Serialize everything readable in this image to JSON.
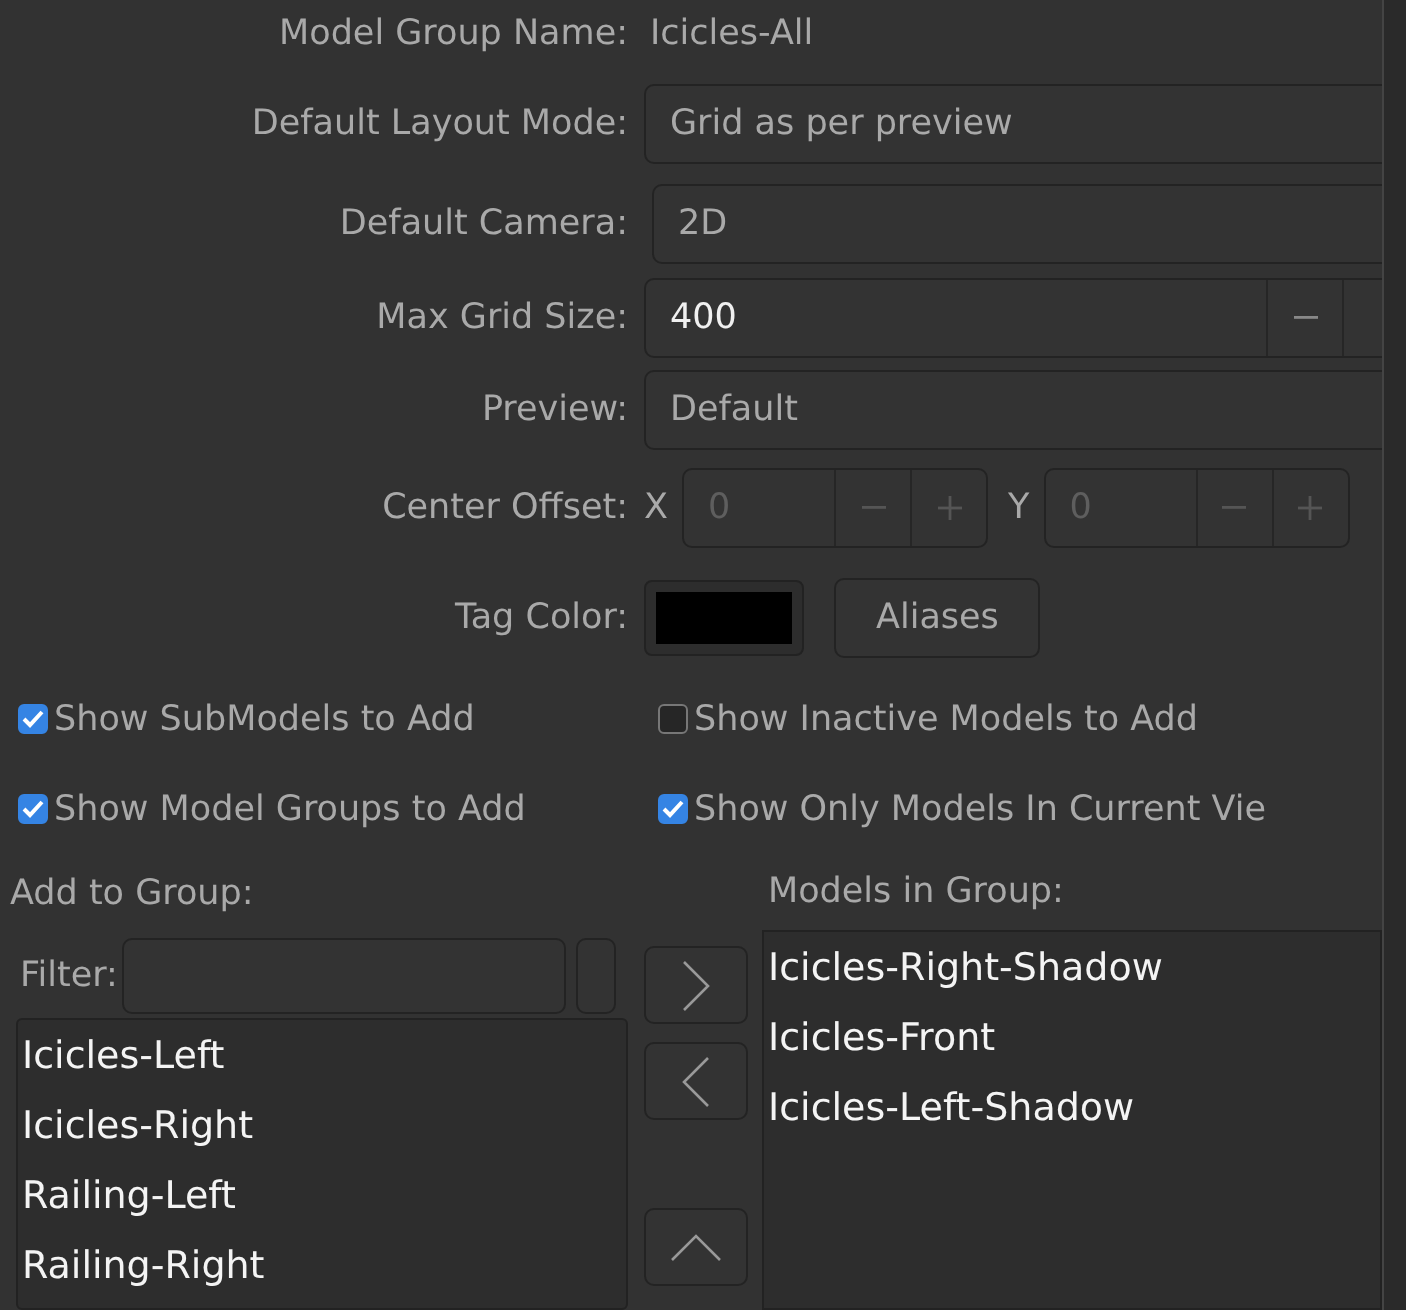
{
  "form": [
    {
      "kind": "text",
      "label": "Model Group Name:",
      "value": "Icicles-All"
    },
    {
      "kind": "dropdown",
      "label": "Default Layout Mode:",
      "value": "Grid as per preview"
    },
    {
      "kind": "dropdown",
      "label": "Default Camera:",
      "value": "2D"
    },
    {
      "kind": "spin",
      "label": "Max Grid Size:",
      "value": "400"
    },
    {
      "kind": "dropdown",
      "label": "Preview:",
      "value": "Default"
    },
    {
      "kind": "offset",
      "label": "Center Offset:",
      "fields": [
        {
          "axis": "X",
          "value": "0",
          "disabled": true
        },
        {
          "axis": "Y",
          "value": "0",
          "disabled": true
        }
      ]
    },
    {
      "kind": "color",
      "label": "Tag Color:",
      "color": "#000000",
      "button": "Aliases"
    }
  ],
  "options": [
    {
      "label": "Show SubModels to Add",
      "checked": true
    },
    {
      "label": "Show Inactive Models to Add",
      "checked": false
    },
    {
      "label": "Show Model Groups to Add",
      "checked": true
    },
    {
      "label": "Show Only Models In Current Vie",
      "checked": true
    }
  ],
  "add_panel": {
    "title": "Add to Group:",
    "filter_label": "Filter:",
    "items": [
      "Icicles-Left",
      "Icicles-Right",
      "Railing-Left",
      "Railing-Right"
    ]
  },
  "group_panel": {
    "title": "Models in Group:",
    "items": [
      "Icicles-Right-Shadow",
      "Icicles-Front",
      "Icicles-Left-Shadow"
    ]
  }
}
